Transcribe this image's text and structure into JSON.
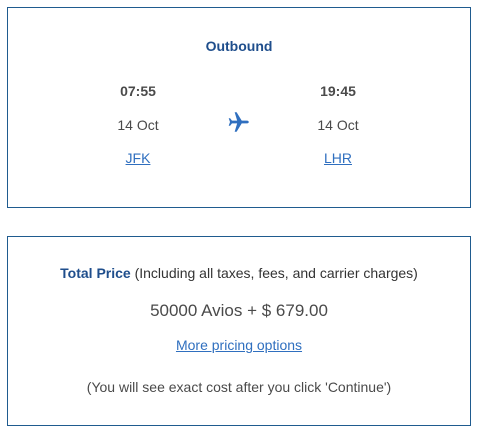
{
  "outbound": {
    "title": "Outbound",
    "departure": {
      "time": "07:55",
      "date": "14 Oct",
      "airport": "JFK"
    },
    "arrival": {
      "time": "19:45",
      "date": "14 Oct",
      "airport": "LHR"
    },
    "icon": "airplane-icon"
  },
  "price": {
    "label": "Total Price",
    "qualifier": "(Including all taxes, fees, and carrier charges)",
    "amount": "50000 Avios + $ 679.00",
    "more_link": "More pricing options",
    "note": "(You will see exact cost after you click 'Continue')"
  },
  "colors": {
    "accent": "#1f4e8c",
    "link": "#2f6fbf",
    "border": "#1f5b8f"
  }
}
